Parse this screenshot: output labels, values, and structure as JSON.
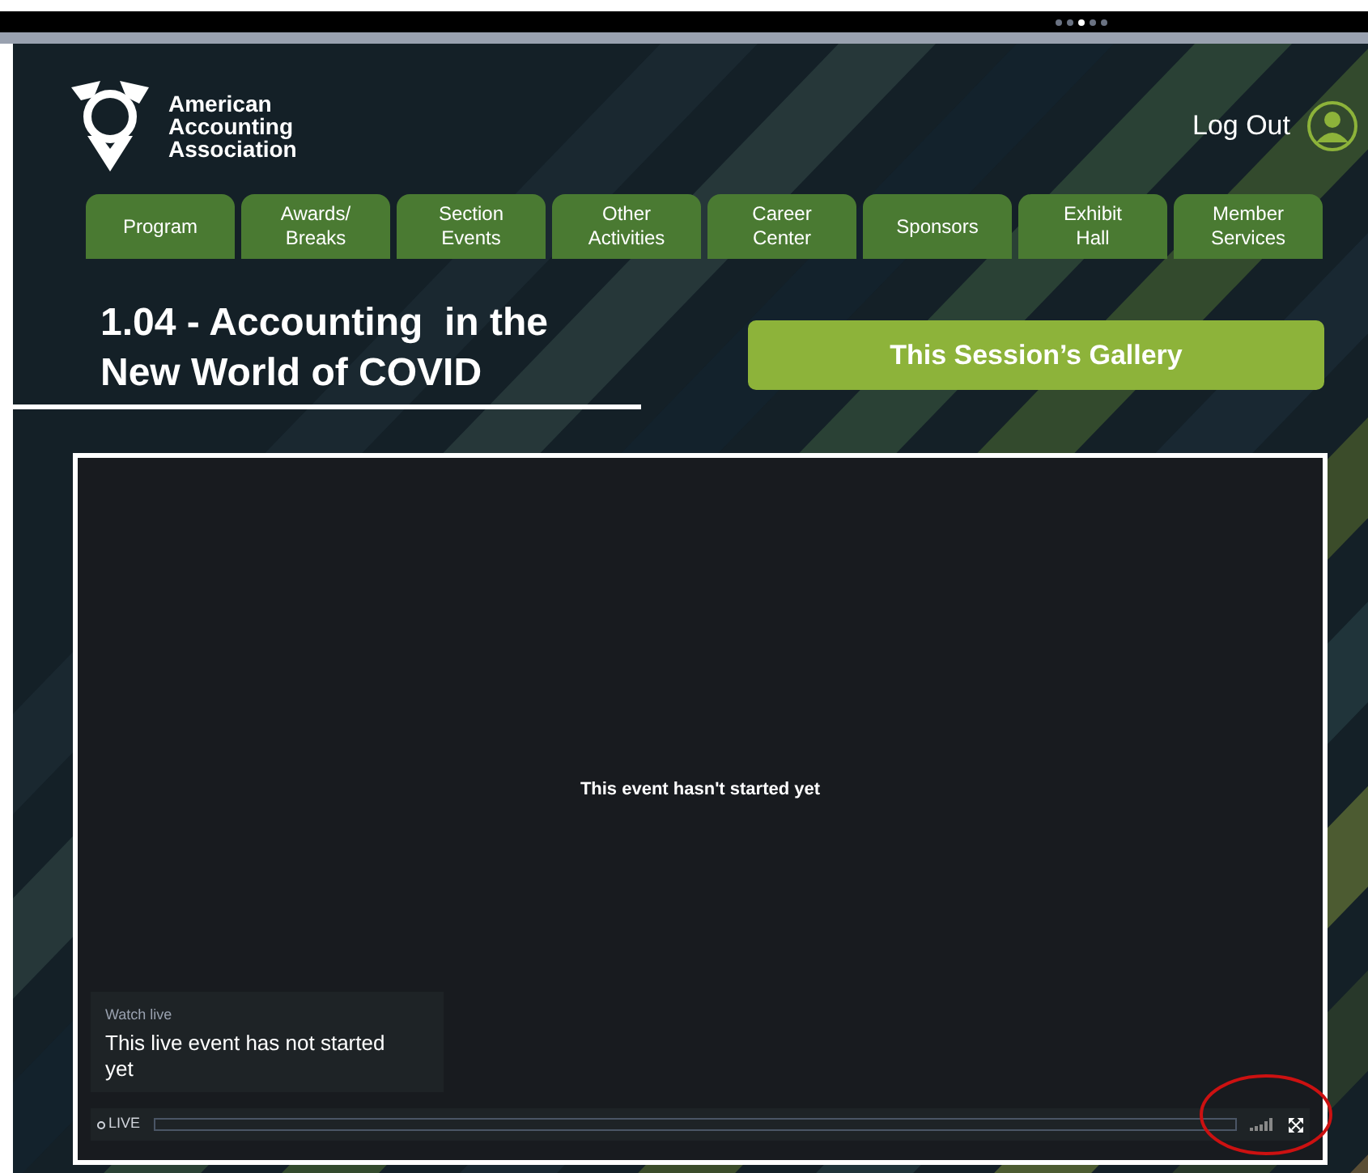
{
  "carousel_dots": [
    {
      "selected": false
    },
    {
      "selected": false
    },
    {
      "selected": true
    },
    {
      "selected": false
    },
    {
      "selected": false
    }
  ],
  "header": {
    "logo_text": "American\nAccounting\nAssociation",
    "logout": "Log Out"
  },
  "nav_tabs": [
    {
      "label": "Program"
    },
    {
      "label": "Awards/\nBreaks"
    },
    {
      "label": "Section\nEvents"
    },
    {
      "label": "Other\nActivities"
    },
    {
      "label": "Career\nCenter"
    },
    {
      "label": "Sponsors"
    },
    {
      "label": "Exhibit\nHall"
    },
    {
      "label": "Member\nServices"
    }
  ],
  "session": {
    "title": "1.04 - Accounting  in the\nNew World of COVID",
    "gallery_button": "This Session’s Gallery"
  },
  "player": {
    "status_message": "This event hasn't started yet",
    "watch_live_label": "Watch live",
    "watch_live_message": "This live event has not started yet",
    "live_label": "LIVE"
  }
}
